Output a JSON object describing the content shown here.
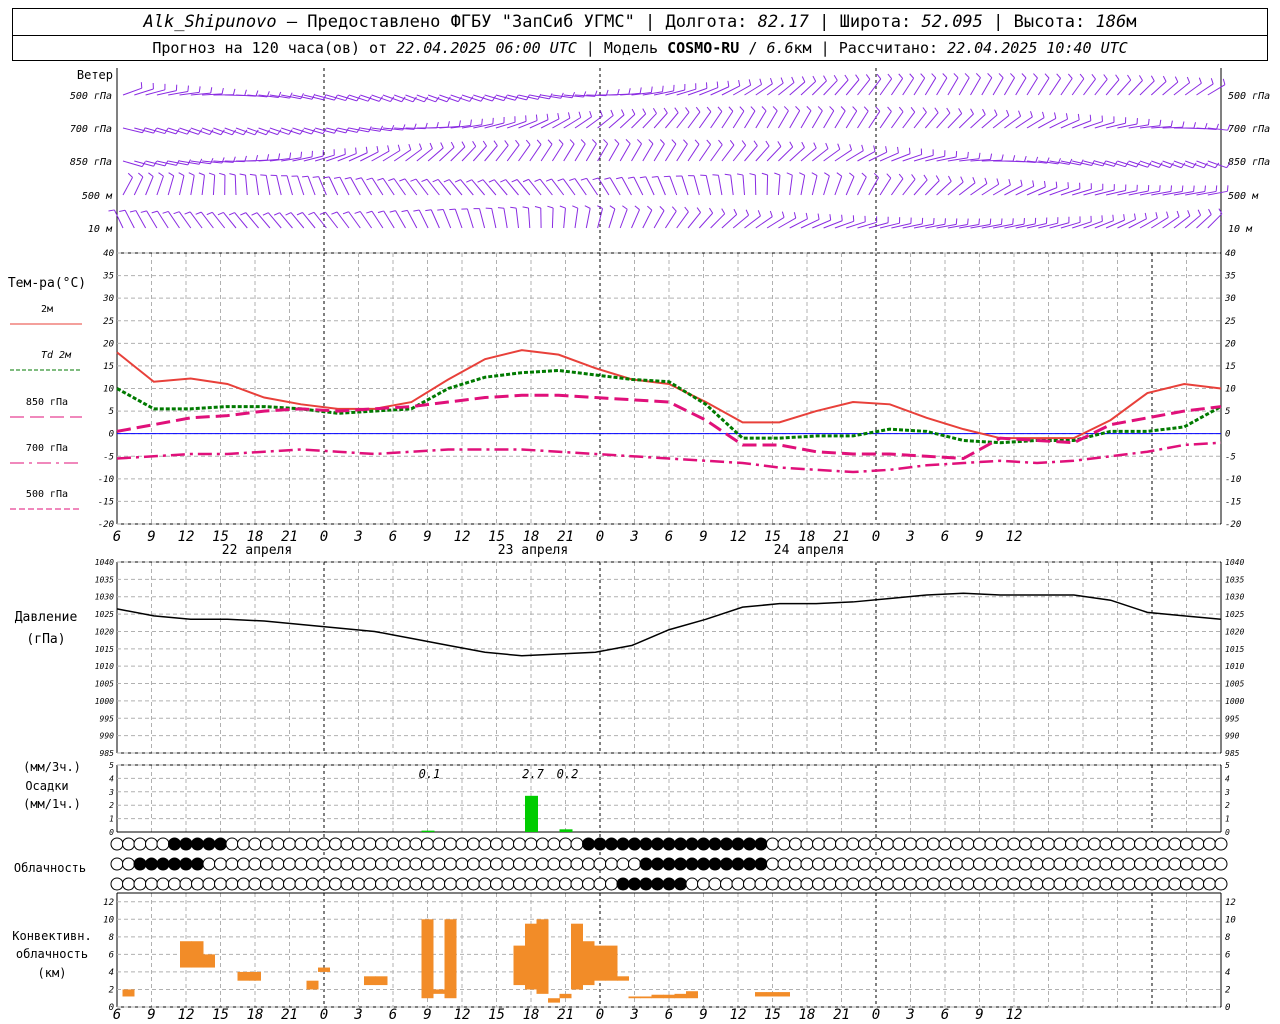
{
  "header": {
    "station": "Alk_Shipunovo",
    "provider": "– Предоставлено ФГБУ \"ЗапСиб УГМС\"",
    "lon_label": "Долгота:",
    "lon_value": "82.17",
    "lat_label": "Широта:",
    "lat_value": "52.095",
    "alt_label": "Высота:",
    "alt_value": "186",
    "alt_unit": "м",
    "forecast_label": "Прогноз на 120 часа(ов) от",
    "forecast_start": "22.04.2025 06:00 UTC",
    "model_label": "Модель",
    "model_name": "COSMO-RU",
    "model_res": "6.6",
    "model_res_unit": "км",
    "computed_label": "Рассчитано:",
    "computed_value": "22.04.2025 10:40 UTC"
  },
  "colors": {
    "t2m": "#e8403a",
    "td2m": "#007a00",
    "t850": "#e0107a",
    "t700": "#e0107a",
    "t500": "#e0107a",
    "wind": "#8a2be2",
    "pressure": "#000000",
    "precip": "#00cc00",
    "conv": "#f28c28",
    "zero_line": "#0000ff"
  },
  "chart_data": [
    {
      "type": "wind_barbs",
      "title": "Ветер",
      "levels": [
        "500 гПа",
        "700 гПа",
        "850 гПа",
        "500 м",
        "10 м"
      ],
      "x_hours": [
        6,
        102
      ]
    },
    {
      "type": "line",
      "title": "Тем-ра(°С)",
      "ylim": [
        -20,
        40
      ],
      "yticks": [
        -20,
        -15,
        -10,
        -5,
        0,
        5,
        10,
        15,
        20,
        25,
        30,
        35,
        40
      ],
      "x_hours": [
        6,
        9,
        12,
        15,
        18,
        21,
        24,
        27,
        30,
        33,
        36,
        39,
        42,
        45,
        48,
        51,
        54,
        57,
        60,
        63,
        66,
        69,
        72,
        75,
        78,
        81,
        84
      ],
      "series": [
        {
          "name": "2м",
          "values": [
            18,
            11.5,
            12.2,
            11,
            8,
            6.5,
            5.5,
            5.5,
            7,
            12,
            16.5,
            18.5,
            17.5,
            14.5,
            12,
            11,
            7,
            2.5,
            2.5,
            5,
            7,
            6.5,
            3.5,
            1,
            -1,
            -1,
            -1,
            3,
            9,
            11,
            10
          ]
        },
        {
          "name": "Td 2м",
          "values": [
            10,
            5.5,
            5.5,
            6,
            6,
            5.5,
            4.5,
            5,
            5.5,
            10,
            12.5,
            13.5,
            14,
            13,
            12,
            11.5,
            6.5,
            -1,
            -1,
            -0.5,
            -0.5,
            1,
            0.5,
            -1.5,
            -2,
            -1.5,
            -1.5,
            0.5,
            0.5,
            1.5,
            6
          ]
        },
        {
          "name": "850 гПа",
          "values": [
            0.5,
            2,
            3.5,
            4,
            5,
            5.5,
            5,
            5.5,
            6,
            7,
            8,
            8.5,
            8.5,
            8,
            7.5,
            7,
            3,
            -2.5,
            -2.5,
            -4,
            -4.5,
            -4.5,
            -5,
            -5.5,
            -1,
            -1.5,
            -2,
            2,
            3.5,
            5,
            6
          ]
        },
        {
          "name": "700 гПа",
          "values": [
            -5.5,
            -5,
            -4.5,
            -4.5,
            -4,
            -3.5,
            -4,
            -4.5,
            -4,
            -3.5,
            -3.5,
            -3.5,
            -4,
            -4.5,
            -5,
            -5.5,
            -6,
            -6.5,
            -7.5,
            -8,
            -8.5,
            -8,
            -7,
            -6.5,
            -6,
            -6.5,
            -6,
            -5,
            -4,
            -2.5,
            -2
          ]
        },
        {
          "name": "500 гПа",
          "values": []
        }
      ],
      "x_axis_labels": [
        "6",
        "9",
        "12",
        "15",
        "18",
        "21",
        "0",
        "3",
        "6",
        "9",
        "12",
        "15",
        "18",
        "21",
        "0",
        "3",
        "6",
        "9",
        "12",
        "15",
        "18",
        "21",
        "0",
        "3",
        "6",
        "9",
        "12"
      ],
      "day_labels": [
        "22 апреля",
        "23 апреля",
        "24 апреля"
      ]
    },
    {
      "type": "line",
      "title": "Давление",
      "unit": "(гПа)",
      "ylim": [
        985,
        1040
      ],
      "yticks": [
        985,
        990,
        995,
        1000,
        1005,
        1010,
        1015,
        1020,
        1025,
        1030,
        1035,
        1040
      ],
      "values": [
        1026.5,
        1024.5,
        1023.5,
        1023.5,
        1023,
        1022,
        1021,
        1020,
        1018,
        1016,
        1014,
        1013,
        1013.5,
        1014,
        1016,
        1020.5,
        1023.5,
        1027,
        1028,
        1028,
        1028.5,
        1029.5,
        1030.5,
        1031,
        1030.5,
        1030.5,
        1030.5,
        1029,
        1025.5,
        1024.5,
        1023.5
      ]
    },
    {
      "type": "bar",
      "title": "Осадки",
      "units": [
        "(мм/3ч.)",
        "(мм/1ч.)"
      ],
      "ylim": [
        0,
        5
      ],
      "yticks": [
        0,
        1,
        2,
        3,
        4,
        5
      ],
      "bars": [
        {
          "hour": 33,
          "value": 0.1
        },
        {
          "hour": 42,
          "value": 2.7
        },
        {
          "hour": 45,
          "value": 0.2
        }
      ],
      "labels": [
        "0.1",
        "2.7",
        "0.2"
      ]
    },
    {
      "type": "cloud_symbols",
      "title": "Облачность",
      "rows": 3
    },
    {
      "type": "bar",
      "title": "Конвективн. облачность (км)",
      "ylim": [
        0,
        13
      ],
      "yticks": [
        0,
        2,
        4,
        6,
        8,
        10,
        12
      ],
      "segments": [
        {
          "h": 7,
          "lo": 1.2,
          "hi": 2
        },
        {
          "h": 12,
          "lo": 4.5,
          "hi": 7.5
        },
        {
          "h": 13,
          "lo": 4.5,
          "hi": 7.5
        },
        {
          "h": 14,
          "lo": 4.5,
          "hi": 6
        },
        {
          "h": 17,
          "lo": 3,
          "hi": 4
        },
        {
          "h": 18,
          "lo": 3,
          "hi": 4
        },
        {
          "h": 23,
          "lo": 2,
          "hi": 3
        },
        {
          "h": 24,
          "lo": 4,
          "hi": 4.5
        },
        {
          "h": 28,
          "lo": 2.5,
          "hi": 3.5
        },
        {
          "h": 29,
          "lo": 2.5,
          "hi": 3.5
        },
        {
          "h": 33,
          "lo": 1,
          "hi": 10
        },
        {
          "h": 34,
          "lo": 1.5,
          "hi": 2
        },
        {
          "h": 35,
          "lo": 1,
          "hi": 10
        },
        {
          "h": 41,
          "lo": 2.5,
          "hi": 7
        },
        {
          "h": 42,
          "lo": 2,
          "hi": 9.5
        },
        {
          "h": 43,
          "lo": 1.5,
          "hi": 10
        },
        {
          "h": 44,
          "lo": 0.5,
          "hi": 1
        },
        {
          "h": 45,
          "lo": 1,
          "hi": 1.5
        },
        {
          "h": 46,
          "lo": 2,
          "hi": 9.5
        },
        {
          "h": 47,
          "lo": 2.5,
          "hi": 7.5
        },
        {
          "h": 48,
          "lo": 3,
          "hi": 7
        },
        {
          "h": 49,
          "lo": 3,
          "hi": 7
        },
        {
          "h": 50,
          "lo": 3,
          "hi": 3.5
        },
        {
          "h": 51,
          "lo": 1,
          "hi": 1.2
        },
        {
          "h": 52,
          "lo": 1,
          "hi": 1.2
        },
        {
          "h": 53,
          "lo": 1,
          "hi": 1.4
        },
        {
          "h": 54,
          "lo": 1,
          "hi": 1.4
        },
        {
          "h": 55,
          "lo": 1,
          "hi": 1.5
        },
        {
          "h": 56,
          "lo": 1,
          "hi": 1.8
        },
        {
          "h": 62,
          "lo": 1.2,
          "hi": 1.7
        },
        {
          "h": 63,
          "lo": 1.2,
          "hi": 1.7
        },
        {
          "h": 64,
          "lo": 1.2,
          "hi": 1.7
        }
      ]
    }
  ]
}
